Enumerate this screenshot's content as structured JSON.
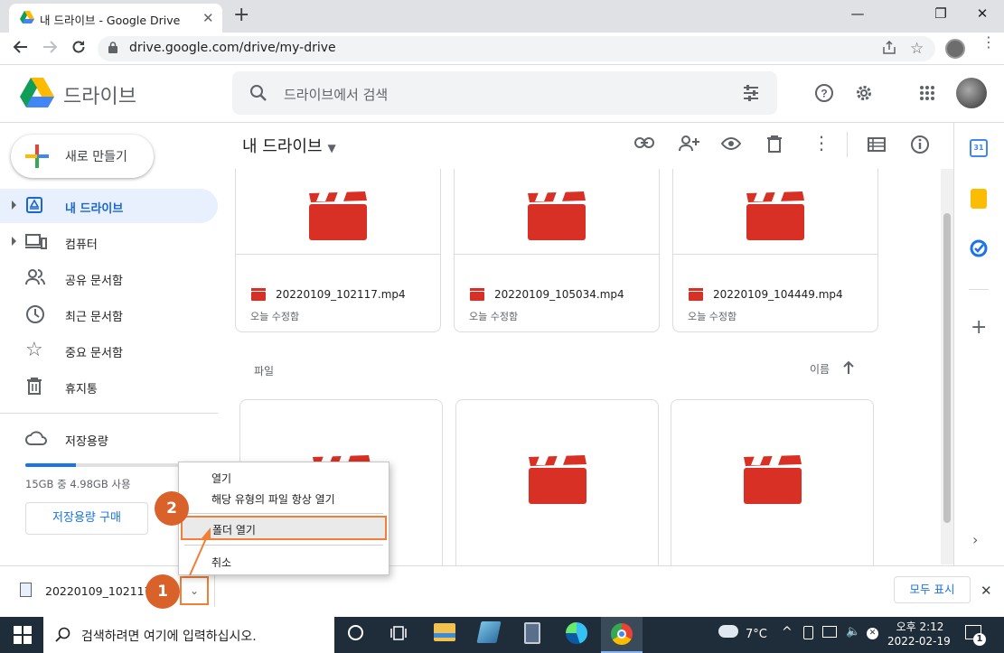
{
  "browser": {
    "tab_title": "내 드라이브 - Google Drive",
    "url": "drive.google.com/drive/my-drive"
  },
  "header": {
    "logo_text": "드라이브",
    "search_placeholder": "드라이브에서 검색"
  },
  "sidebar": {
    "new_label": "새로 만들기",
    "items": [
      {
        "label": "내 드라이브",
        "icon": "my-drive-icon",
        "active": true
      },
      {
        "label": "컴퓨터",
        "icon": "computer-icon"
      },
      {
        "label": "공유 문서함",
        "icon": "shared-icon"
      },
      {
        "label": "최근 문서함",
        "icon": "recent-clock-icon"
      },
      {
        "label": "중요 문서함",
        "icon": "star-icon"
      },
      {
        "label": "휴지통",
        "icon": "trash-icon"
      }
    ],
    "storage_label": "저장용량",
    "storage_text": "15GB 중 4.98GB 사용",
    "storage_fraction": 0.332,
    "buy_label": "저장용량 구매"
  },
  "main": {
    "title": "내 드라이브",
    "top_files": [
      {
        "name": "20220109_102117.mp4",
        "meta": "오늘 수정함"
      },
      {
        "name": "20220109_105034.mp4",
        "meta": "오늘 수정함"
      },
      {
        "name": "20220109_104449.mp4",
        "meta": "오늘 수정함"
      }
    ],
    "files_label": "파일",
    "sort_label": "이름"
  },
  "context_menu": {
    "open": "열기",
    "always_open": "해당 유형의 파일 항상 열기",
    "show_folder": "폴더 열기",
    "cancel": "취소"
  },
  "callouts": {
    "one": "1",
    "two": "2"
  },
  "download_bar": {
    "filename": "20220109_102117.",
    "show_all": "모두 표시"
  },
  "taskbar": {
    "search_placeholder": "검색하려면 여기에 입력하십시오.",
    "temperature": "7°C",
    "time": "오후 2:12",
    "date": "2022-02-19",
    "notifications": "1"
  },
  "colors": {
    "accent": "#1a73e8",
    "video_red": "#d93025",
    "callout_orange": "#f07f37"
  }
}
